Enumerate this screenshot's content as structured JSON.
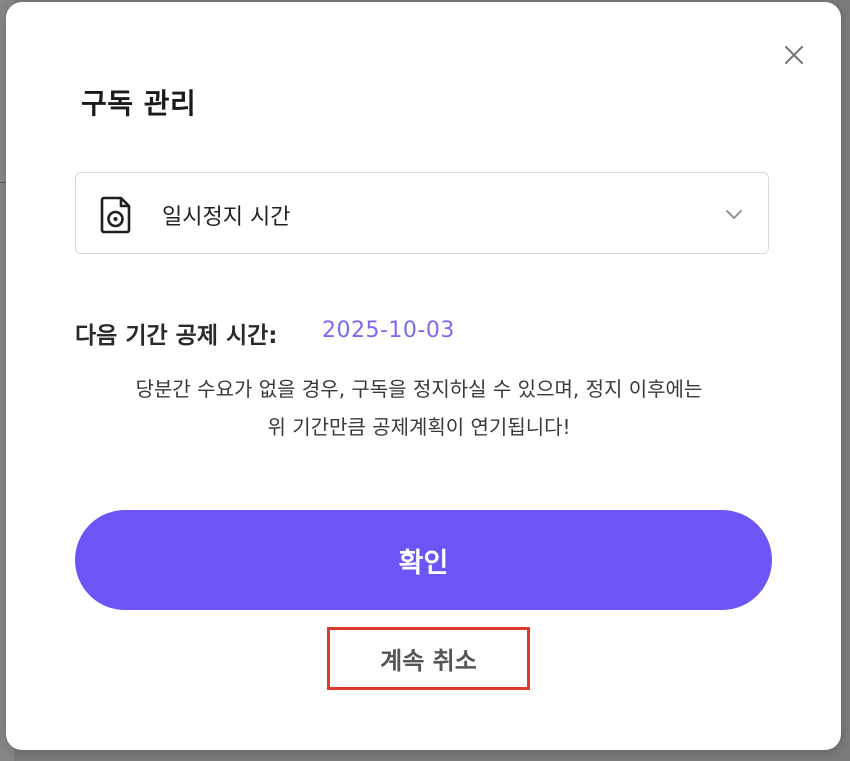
{
  "dialog": {
    "title": "구독 관리",
    "close_icon": "close-icon",
    "select": {
      "icon": "document-clock-icon",
      "value": "일시정지 시간",
      "chevron_icon": "chevron-down-icon"
    },
    "next_deduction": {
      "label": "다음 기간 공제 시간:",
      "date": "2025-10-03"
    },
    "description": {
      "line1": "당분간 수요가 없을 경우, 구독을 정지하실 수 있으며, 정지 이후에는",
      "line2": "위 기간만큼 공제계획이 연기됩니다!"
    },
    "confirm_label": "확인",
    "cancel_label": "계속 취소"
  },
  "colors": {
    "accent": "#6a56f7",
    "date": "#7a6cf0",
    "highlight_border": "#e03a2f"
  }
}
